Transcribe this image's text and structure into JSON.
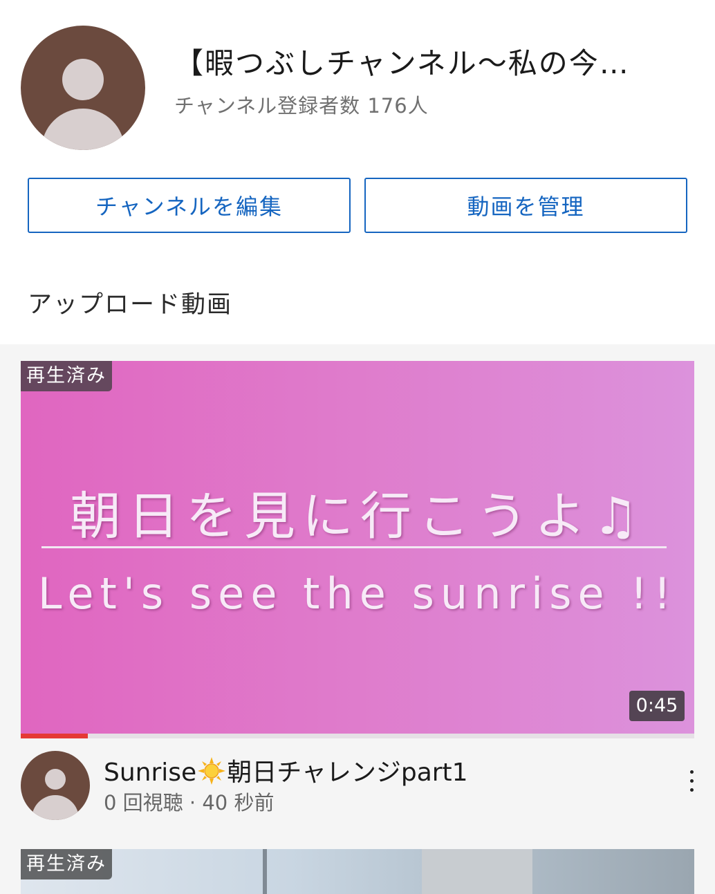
{
  "channel": {
    "title": "【暇つぶしチャンネル〜私の今…",
    "subscribers": "チャンネル登録者数 176人"
  },
  "buttons": {
    "edit_channel": "チャンネルを編集",
    "manage_videos": "動画を管理"
  },
  "section": {
    "title": "アップロード動画"
  },
  "videos": [
    {
      "watched_badge": "再生済み",
      "thumbnail_text_jp": "朝日を見に行こうよ♫",
      "thumbnail_text_en": "Let's see the sunrise !!",
      "duration": "0:45",
      "progress": 0.1,
      "title_part1": "Sunrise",
      "title_part2": "朝日チャレンジpart1",
      "meta": "0 回視聴 · 40 秒前"
    },
    {
      "watched_badge": "再生済み"
    }
  ],
  "colors": {
    "accent": "#1565c0",
    "progress": "#e53935",
    "avatar": "#6b4a3e"
  }
}
